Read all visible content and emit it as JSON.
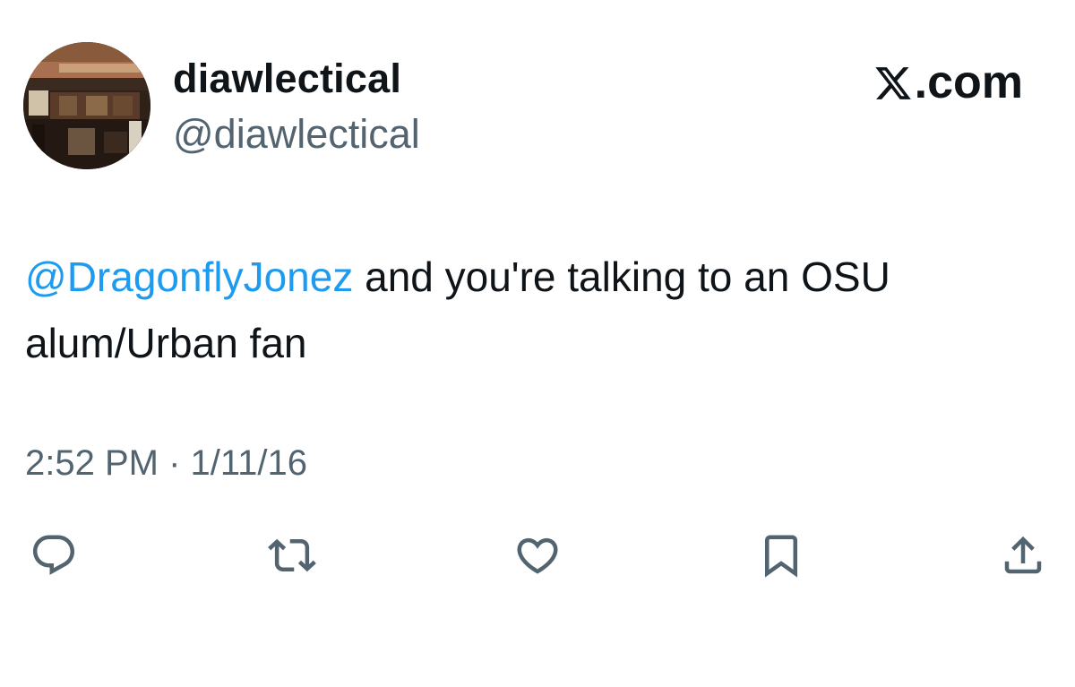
{
  "user": {
    "display_name": "diawlectical",
    "handle": "@diawlectical"
  },
  "brand": {
    "text": ".com",
    "icon": "x-logo-icon"
  },
  "tweet": {
    "mention": "@DragonflyJonez",
    "text": " and you're talking to an OSU alum/Urban fan"
  },
  "meta": {
    "timestamp": "2:52 PM · 1/11/16"
  },
  "actions": {
    "reply_icon": "reply-icon",
    "retweet_icon": "retweet-icon",
    "like_icon": "like-icon",
    "bookmark_icon": "bookmark-icon",
    "share_icon": "share-icon"
  },
  "colors": {
    "mention": "#1d9bf0",
    "secondary_text": "#536471",
    "primary_text": "#0f1419"
  }
}
